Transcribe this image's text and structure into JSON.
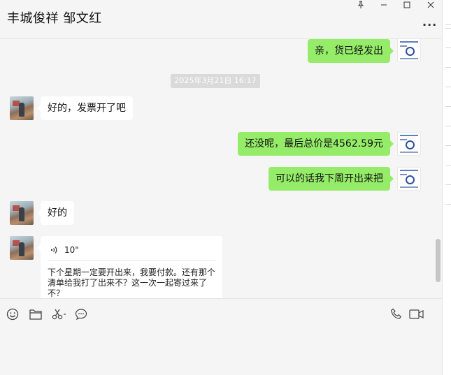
{
  "header": {
    "title": "丰城俊祥 邹文红",
    "controls": {
      "pin": "pin-icon",
      "minimize": "minimize-icon",
      "maximize": "maximize-icon",
      "close": "close-icon"
    },
    "more_label": "..."
  },
  "timestamp": "2025年3月21日 16:17",
  "messages": [
    {
      "side": "out",
      "text": "亲，货已经发出"
    },
    {
      "side": "in",
      "text": "好的，发票开了吧"
    },
    {
      "side": "out",
      "text": "还没呢，最后总价是4562.59元"
    },
    {
      "side": "out",
      "text": "可以的话我下周开出来把"
    },
    {
      "side": "in",
      "text": "好的"
    }
  ],
  "voice_message": {
    "duration": "10\"",
    "transcript": "下个星期一定要开出来，我要付款。还有那个清单给我打了出来不？这一次一起寄过来了不？"
  },
  "toolbar": {
    "left": [
      "emoji-icon",
      "folder-icon",
      "scissors-icon",
      "chat-bubble-icon"
    ],
    "right": [
      "phone-icon",
      "video-icon"
    ]
  },
  "colors": {
    "outgoing_bubble": "#95ec69",
    "incoming_bubble": "#ffffff",
    "background": "#f5f5f5"
  }
}
